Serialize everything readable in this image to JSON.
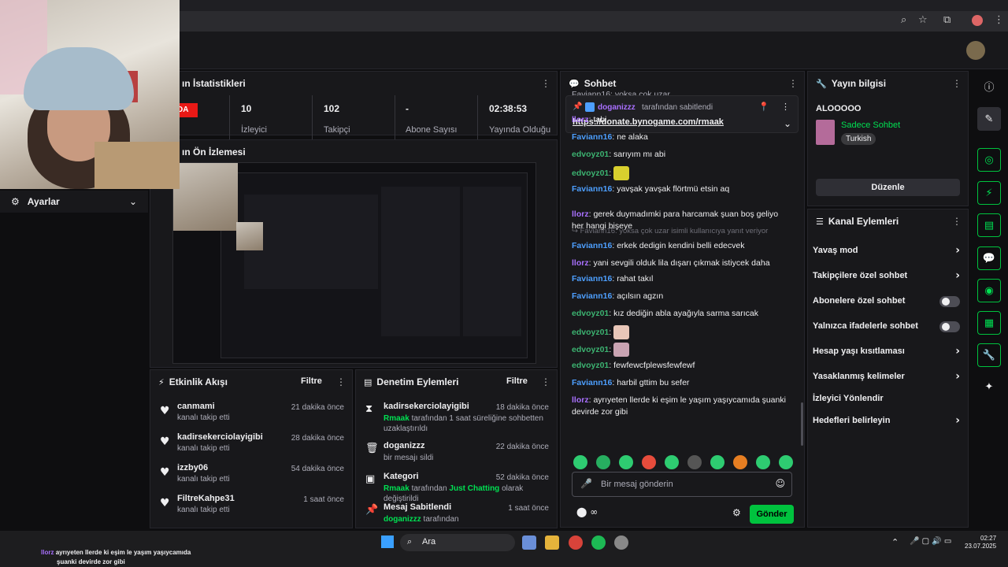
{
  "stats": {
    "title": "ın İstatistikleri",
    "badge": "DA",
    "items": [
      {
        "value": "10",
        "label": "İzleyici"
      },
      {
        "value": "102",
        "label": "Takipçi"
      },
      {
        "value": "-",
        "label": "Abone Sayısı"
      },
      {
        "value": "02:38:53",
        "label": "Yayında Olduğu"
      }
    ]
  },
  "preview": {
    "title": "ın Ön İzlemesi"
  },
  "settings": {
    "label": "Ayarlar"
  },
  "activity": {
    "title": "Etkinlik Akışı",
    "filter": "Filtre",
    "items": [
      {
        "name": "canmami",
        "sub": "kanalı takip etti",
        "time": "21 dakika önce"
      },
      {
        "name": "kadirsekerciolayigibi",
        "sub": "kanalı takip etti",
        "time": "28 dakika önce"
      },
      {
        "name": "izzby06",
        "sub": "kanalı takip etti",
        "time": "54 dakika önce"
      },
      {
        "name": "FiltreKahpe31",
        "sub": "kanalı takip etti",
        "time": "1 saat önce"
      }
    ]
  },
  "moderation": {
    "title": "Denetim Eylemleri",
    "filter": "Filtre",
    "items": [
      {
        "name": "kadirsekerciolayigibi",
        "actor": "Rmaak",
        "desc": " tarafından 1 saat süreliğine sohbetten uzaklaştırıldı",
        "time": "18 dakika önce"
      },
      {
        "name": "doganizzz",
        "actor": "",
        "desc": "bir mesajı sildi",
        "time": "22 dakika önce"
      },
      {
        "name": "Kategori",
        "actor": "Rmaak",
        "desc": " tarafından ",
        "extra": "Just Chatting",
        "desc2": " olarak değiştirildi",
        "time": "52 dakika önce"
      },
      {
        "name": "Mesaj Sabitlendi",
        "actor": "doganizzz",
        "desc": " tarafından",
        "time": "1 saat önce"
      }
    ]
  },
  "chat": {
    "title": "Sohbet",
    "top_partial": "Faviann16: yoksa çok uzar",
    "pinned": {
      "user": "doganizzz",
      "by": "tarafından sabitlendi",
      "link": "https://donate.bynogame.com/rmaak"
    },
    "messages": [
      {
        "user": "llorz",
        "text": "tabi",
        "color": "purple"
      },
      {
        "user": "Faviann16",
        "text": "ne alaka",
        "color": "blue"
      },
      {
        "user": "edvoyz01",
        "text": "sarıyım mı abi",
        "color": "green"
      },
      {
        "user": "edvoyz01",
        "text": "",
        "color": "green"
      },
      {
        "user": "Faviann16",
        "text": "yavşak yavşak flörtmü etsin aq",
        "color": "blue"
      },
      {
        "user": "llorz",
        "text": "gerek duymadımki para harcamak şuan boş geliyo her hangi bişeye",
        "color": "purple"
      },
      {
        "user": "Faviann16",
        "text": "erkek dedigin kendini belli edecvek",
        "color": "blue"
      },
      {
        "user": "llorz",
        "text": "yani sevgili olduk lila dışarı çıkmak istiycek daha",
        "color": "purple"
      },
      {
        "user": "Faviann16",
        "text": "rahat takıl",
        "color": "blue"
      },
      {
        "user": "Faviann16",
        "text": "açılsın agzın",
        "color": "blue"
      },
      {
        "user": "edvoyz01",
        "text": "kız dediğin abla ayağıyla sarma sarıcak",
        "color": "green"
      },
      {
        "user": "edvoyz01",
        "text": "",
        "color": "green"
      },
      {
        "user": "edvoyz01",
        "text": "",
        "color": "green"
      },
      {
        "user": "edvoyz01",
        "text": "fewfewcfplewsfewfewf",
        "color": "green"
      },
      {
        "user": "Faviann16",
        "text": "harbil gttim bu sefer",
        "color": "blue"
      },
      {
        "user": "llorz",
        "text": "ayrıyeten llerde ki eşim le yaşım yaşıycamıda şuanki devirde zor gibi",
        "color": "purple"
      }
    ],
    "reply_hint": "Faviann16: yoksa çok uzar isimli kullanıcıya yanıt veriyor",
    "input_placeholder": "Bir mesaj gönderin",
    "send": "Gönder"
  },
  "stream_info": {
    "title": "Yayın bilgisi",
    "stream_title": "ALOOOOO",
    "category": "Sadece Sohbet",
    "language": "Turkish",
    "edit": "Düzenle"
  },
  "channel_actions": {
    "title": "Kanal Eylemleri",
    "items": [
      {
        "label": "Yavaş mod",
        "kind": "chevron"
      },
      {
        "label": "Takipçilere özel sohbet",
        "kind": "chevron"
      },
      {
        "label": "Abonelere özel sohbet",
        "kind": "toggle"
      },
      {
        "label": "Yalnızca ifadelerle sohbet",
        "kind": "toggle"
      },
      {
        "label": "Hesap yaşı kısıtlaması",
        "kind": "chevron"
      },
      {
        "label": "Yasaklanmış kelimeler",
        "kind": "chevron"
      },
      {
        "label": "İzleyici Yönlendir",
        "kind": "none"
      },
      {
        "label": "Hedefleri belirleyin",
        "kind": "chevron"
      }
    ]
  },
  "overlay_caption": {
    "user": "llorz",
    "line1": "ayrıyeten llerde ki eşim le yaşım yaşıycamıda",
    "line2": "şuanki devirde zor gibi"
  },
  "taskbar": {
    "search": "Ara",
    "time": "02:27",
    "date": "23.07.2025"
  }
}
